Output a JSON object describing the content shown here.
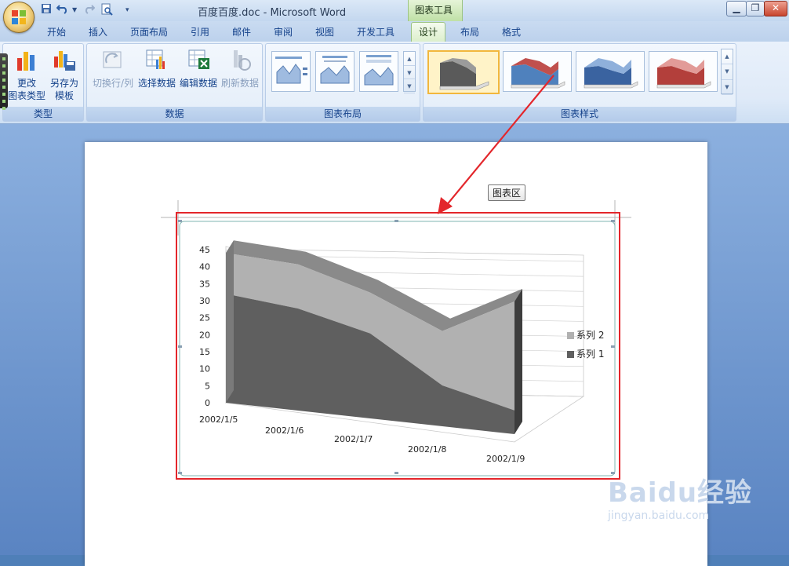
{
  "window": {
    "title": "百度百度.doc - Microsoft Word",
    "context_tab": "图表工具"
  },
  "tabs": [
    {
      "label": "开始"
    },
    {
      "label": "插入"
    },
    {
      "label": "页面布局"
    },
    {
      "label": "引用"
    },
    {
      "label": "邮件"
    },
    {
      "label": "审阅"
    },
    {
      "label": "视图"
    },
    {
      "label": "开发工具"
    },
    {
      "label": "设计",
      "active": true
    },
    {
      "label": "布局"
    },
    {
      "label": "格式"
    }
  ],
  "ribbon": {
    "type_group": {
      "label": "类型",
      "change_type": {
        "line1": "更改",
        "line2": "图表类型"
      },
      "save_template": {
        "line1": "另存为",
        "line2": "模板"
      }
    },
    "data_group": {
      "label": "数据",
      "switch_row_col": "切换行/列",
      "select_data": "选择数据",
      "edit_data": "编辑数据",
      "refresh_data": "刷新数据"
    },
    "layout_group": {
      "label": "图表布局"
    },
    "style_group": {
      "label": "图表样式"
    }
  },
  "colors": {
    "accent_red": "#e3262b",
    "series1": "#5f5f5f",
    "series2": "#b1b1b1",
    "style_gray": "#7f7f7f",
    "style_red": "#c0504d",
    "style_blue": "#4f81bd"
  },
  "tooltip": "图表区",
  "chart_data": {
    "type": "area",
    "categories": [
      "2002/1/5",
      "2002/1/6",
      "2002/1/7",
      "2002/1/8",
      "2002/1/9"
    ],
    "series": [
      {
        "name": "系列 1",
        "values": [
          32,
          30,
          25,
          12,
          7
        ]
      },
      {
        "name": "系列 2",
        "values": [
          12,
          13,
          12,
          16,
          32
        ]
      }
    ],
    "stacked": true,
    "three_d": true,
    "ylim": [
      0,
      45
    ],
    "y_ticks": [
      "0",
      "5",
      "10",
      "15",
      "20",
      "25",
      "30",
      "35",
      "40",
      "45"
    ],
    "legend_position": "right",
    "grid": true
  },
  "watermark": {
    "line1": "Baidu经验",
    "line2": "jingyan.baidu.com"
  }
}
